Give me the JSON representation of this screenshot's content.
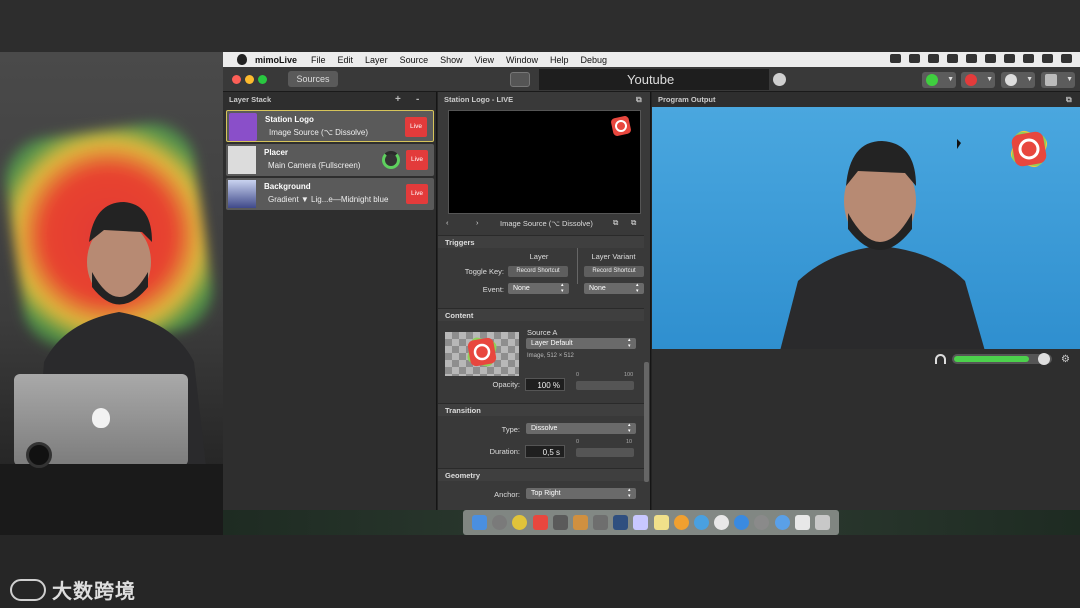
{
  "menubar": {
    "app_name": "mimoLive",
    "items": [
      "File",
      "Edit",
      "Layer",
      "Source",
      "Show",
      "View",
      "Window",
      "Help",
      "Debug"
    ]
  },
  "toolbar": {
    "sources_label": "Sources",
    "document_title": "Youtube"
  },
  "layer_stack": {
    "title": "Layer Stack",
    "add_label": "+",
    "remove_label": "-",
    "layers": [
      {
        "name": "Station Logo",
        "subtitle": "Image Source (⌥ Dissolve)",
        "live": "Live"
      },
      {
        "name": "Placer",
        "subtitle": "Main Camera (Fullscreen)",
        "live": "Live"
      },
      {
        "name": "Background",
        "subtitle": "Gradient ▼ Lig...e—Midnight blue",
        "live": "Live"
      }
    ]
  },
  "settings": {
    "title": "Station Logo - LIVE",
    "source_nav_label": "Image Source (⌥ Dissolve)",
    "triggers": {
      "header": "Triggers",
      "col_layer": "Layer",
      "col_variant": "Layer Variant",
      "toggle_key_label": "Toggle Key:",
      "record_shortcut": "Record Shortcut",
      "event_label": "Event:",
      "event_value": "None"
    },
    "content": {
      "header": "Content",
      "source_label": "Source A",
      "source_value": "Layer Default",
      "image_info": "Image, 512 × 512",
      "opacity_label": "Opacity:",
      "opacity_value": "100 %",
      "opacity_min": "0",
      "opacity_max": "100"
    },
    "transition": {
      "header": "Transition",
      "type_label": "Type:",
      "type_value": "Dissolve",
      "duration_label": "Duration:",
      "duration_value": "0,5 s",
      "duration_min": "0",
      "duration_max": "10"
    },
    "geometry": {
      "header": "Geometry",
      "anchor_label": "Anchor:",
      "anchor_value": "Top Right"
    }
  },
  "program_output": {
    "title": "Program Output",
    "audio_level": 0.78
  },
  "watermark": {
    "text": "大数跨境"
  },
  "colors": {
    "live_red": "#e33b3b",
    "selection_gold": "#d6c45a",
    "program_blue": "#3a9bd8",
    "audio_green": "#4cd04c"
  }
}
